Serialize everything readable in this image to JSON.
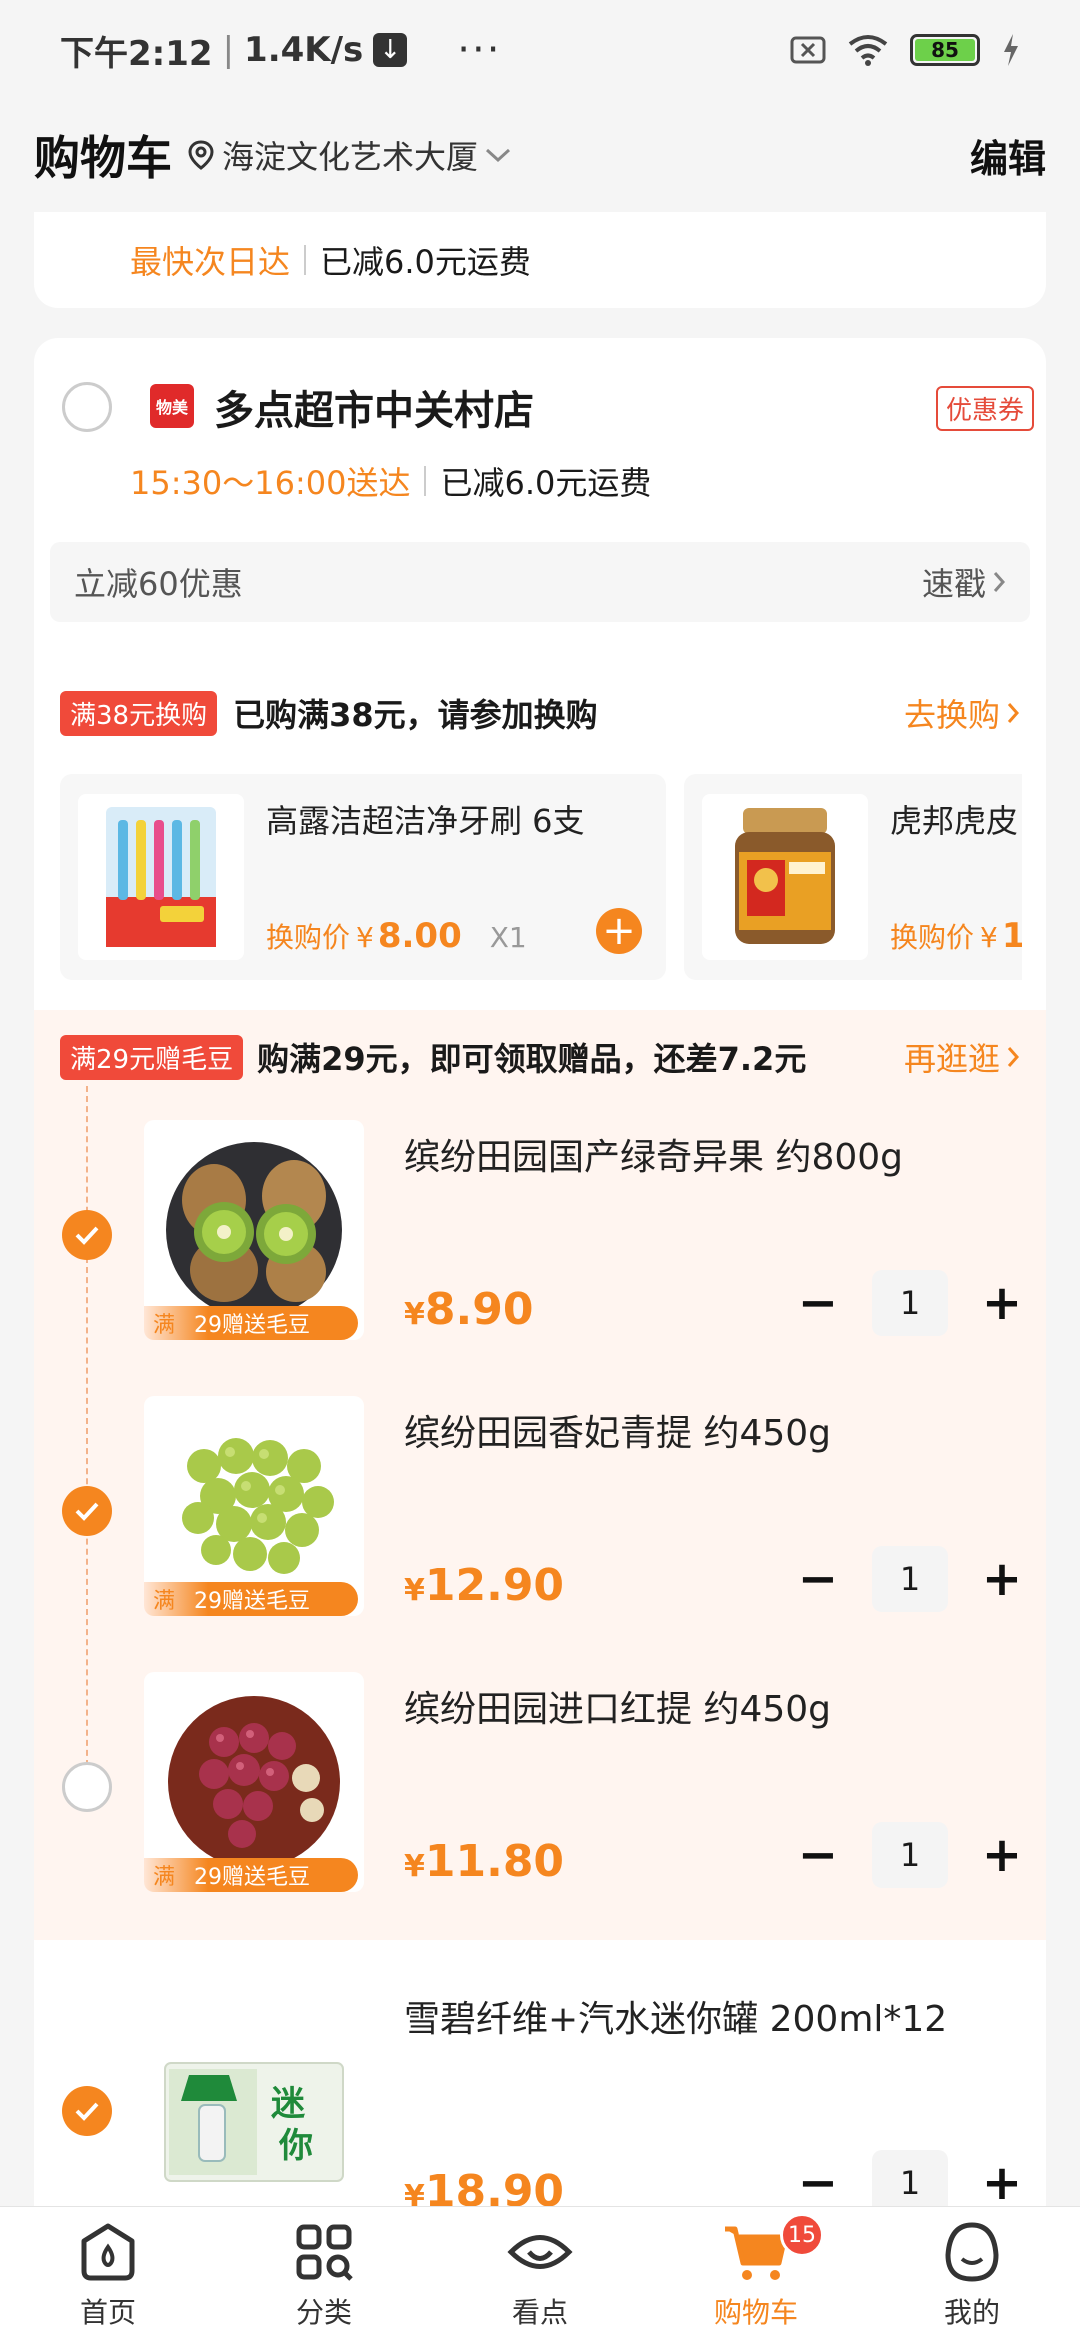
{
  "status_bar": {
    "time": "下午2:12",
    "speed": "1.4K/s",
    "dots": "···",
    "battery": "85"
  },
  "header": {
    "title": "购物车",
    "location": "海淀文化艺术大厦",
    "edit": "编辑"
  },
  "prev_store": {
    "delivery": "最快次日达",
    "shipping": "已减6.0元运费"
  },
  "store": {
    "logo_text": "物美",
    "name": "多点超市中关村店",
    "coupon": "优惠券",
    "delivery": "15:30～16:00送达",
    "shipping": "已减6.0元运费",
    "promo": "立减60优惠",
    "promo_action": "速戳"
  },
  "swap": {
    "tag": "满38元换购",
    "text": "已购满38元，请参加换购",
    "action": "去换购",
    "items": [
      {
        "name": "高露洁超洁净牙刷 6支",
        "price_label": "换购价",
        "currency": "¥",
        "price": "8.00",
        "qty": "X1"
      },
      {
        "name": "虎邦虎皮",
        "price_label": "换购价",
        "currency": "¥",
        "price": "1"
      }
    ]
  },
  "gift": {
    "tag": "满29元赠毛豆",
    "text": "购满29元，即可领取赠品，还差7.2元",
    "action": "再逛逛"
  },
  "products": [
    {
      "name": "缤纷田园国产绿奇异果 约800g",
      "currency": "¥",
      "price": "8.90",
      "qty": "1",
      "checked": true,
      "badge_m": "满",
      "badge": "29赠送毛豆"
    },
    {
      "name": "缤纷田园香妃青提 约450g",
      "currency": "¥",
      "price": "12.90",
      "qty": "1",
      "checked": true,
      "badge_m": "满",
      "badge": "29赠送毛豆"
    },
    {
      "name": "缤纷田园进口红提 约450g",
      "currency": "¥",
      "price": "11.80",
      "qty": "1",
      "checked": false,
      "badge_m": "满",
      "badge": "29赠送毛豆"
    },
    {
      "name": "雪碧纤维+汽水迷你罐 200ml*12",
      "currency": "¥",
      "price": "18.90",
      "qty": "1",
      "checked": true
    }
  ],
  "nav": {
    "items": [
      "首页",
      "分类",
      "看点",
      "购物车",
      "我的"
    ],
    "cart_badge": "15"
  },
  "colors": {
    "accent": "#f5861f",
    "tag_red": "#f04a3a"
  }
}
